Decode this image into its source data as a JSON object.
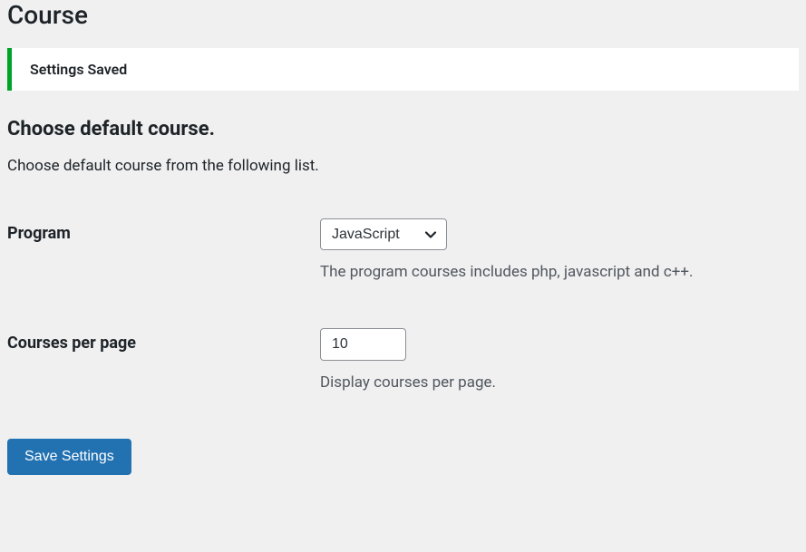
{
  "page": {
    "title": "Course"
  },
  "notice": {
    "message": "Settings Saved"
  },
  "section": {
    "heading": "Choose default course.",
    "description": "Choose default course from the following list."
  },
  "fields": {
    "program": {
      "label": "Program",
      "value": "JavaScript",
      "help": "The program courses includes php, javascript and c++."
    },
    "per_page": {
      "label": "Courses per page",
      "value": "10",
      "help": "Display courses per page."
    }
  },
  "actions": {
    "save": "Save Settings"
  }
}
